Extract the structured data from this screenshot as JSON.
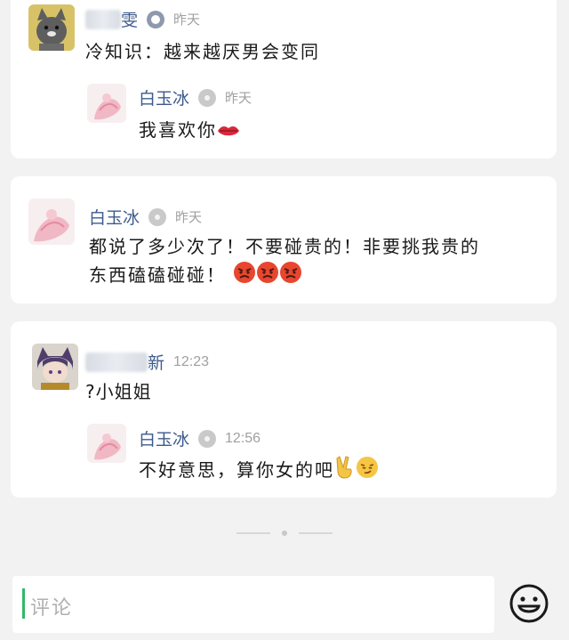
{
  "comments": [
    {
      "author_visible": "雯",
      "time": "昨天",
      "text": "冷知识：越来越厌男会变同",
      "reply": {
        "author": "白玉冰",
        "time": "昨天",
        "text": "我喜欢你"
      }
    },
    {
      "author": "白玉冰",
      "time": "昨天",
      "text_line1": "都说了多少次了！不要碰贵的！非要挑我贵的",
      "text_line2": "东西磕磕碰碰！"
    },
    {
      "author_visible": "新",
      "time": "12:23",
      "text": "?小姐姐",
      "reply": {
        "author": "白玉冰",
        "time": "12:56",
        "text": "不好意思，算你女的吧"
      }
    }
  ],
  "comment_input": {
    "placeholder": "评论"
  },
  "icons": {
    "verified": "verified-badge-icon",
    "emoji_button": "smiley-face-icon",
    "kiss": "lips-emoji-icon",
    "angry": "angry-face-emoji-icon",
    "victory": "victory-hand-emoji-icon",
    "smirk": "smirk-face-emoji-icon"
  },
  "colors": {
    "name": "#3d5a8c",
    "time": "#a0a0a0",
    "caret": "#33b86b"
  }
}
